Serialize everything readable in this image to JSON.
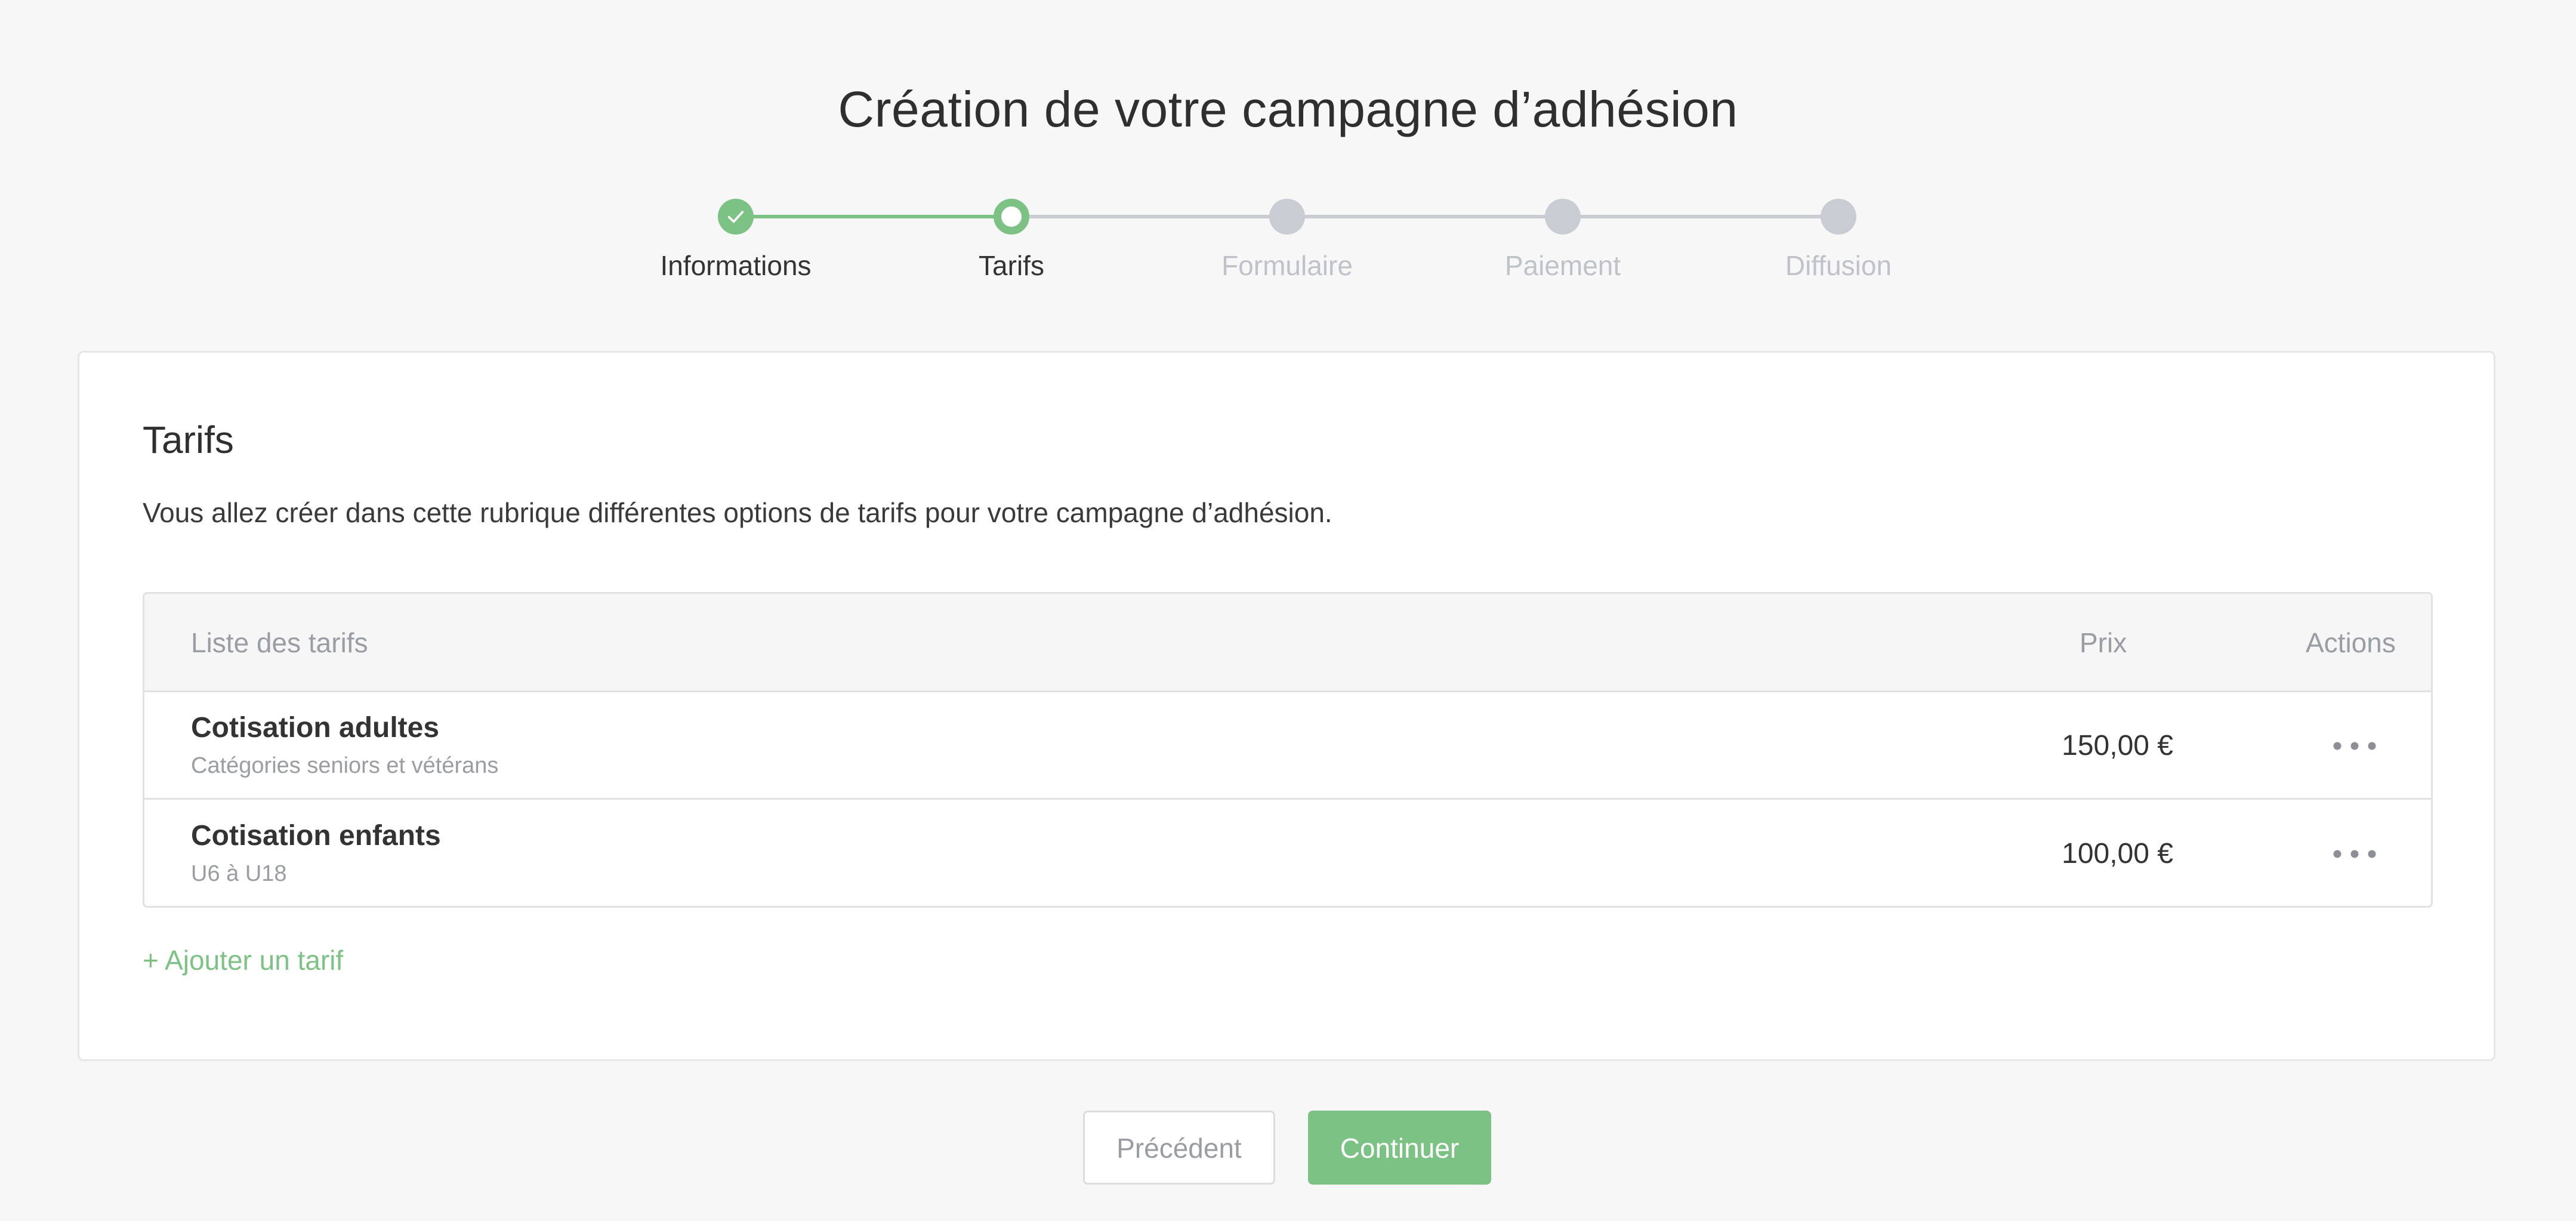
{
  "page": {
    "title": "Création de votre campagne d’adhésion"
  },
  "stepper": {
    "steps": [
      {
        "label": "Informations",
        "status": "done"
      },
      {
        "label": "Tarifs",
        "status": "current"
      },
      {
        "label": "Formulaire",
        "status": "pending"
      },
      {
        "label": "Paiement",
        "status": "pending"
      },
      {
        "label": "Diffusion",
        "status": "pending"
      }
    ]
  },
  "card": {
    "title": "Tarifs",
    "description": "Vous allez créer dans cette rubrique différentes options de tarifs pour votre campagne d’adhésion."
  },
  "table": {
    "columns": {
      "name": "Liste des tarifs",
      "price": "Prix",
      "actions": "Actions"
    },
    "rows": [
      {
        "name": "Cotisation adultes",
        "subtitle": "Catégories seniors et vétérans",
        "price": "150,00 €",
        "actions_icon": "more-horizontal-icon"
      },
      {
        "name": "Cotisation enfants",
        "subtitle": "U6 à U18",
        "price": "100,00 €",
        "actions_icon": "more-horizontal-icon"
      }
    ]
  },
  "add_link": {
    "label": "+ Ajouter un tarif"
  },
  "footer": {
    "prev_label": "Précédent",
    "next_label": "Continuer"
  },
  "colors": {
    "accent": "#7cc285",
    "inactive": "#c9ccd3",
    "background": "#f7f7f7",
    "card": "#ffffff"
  }
}
